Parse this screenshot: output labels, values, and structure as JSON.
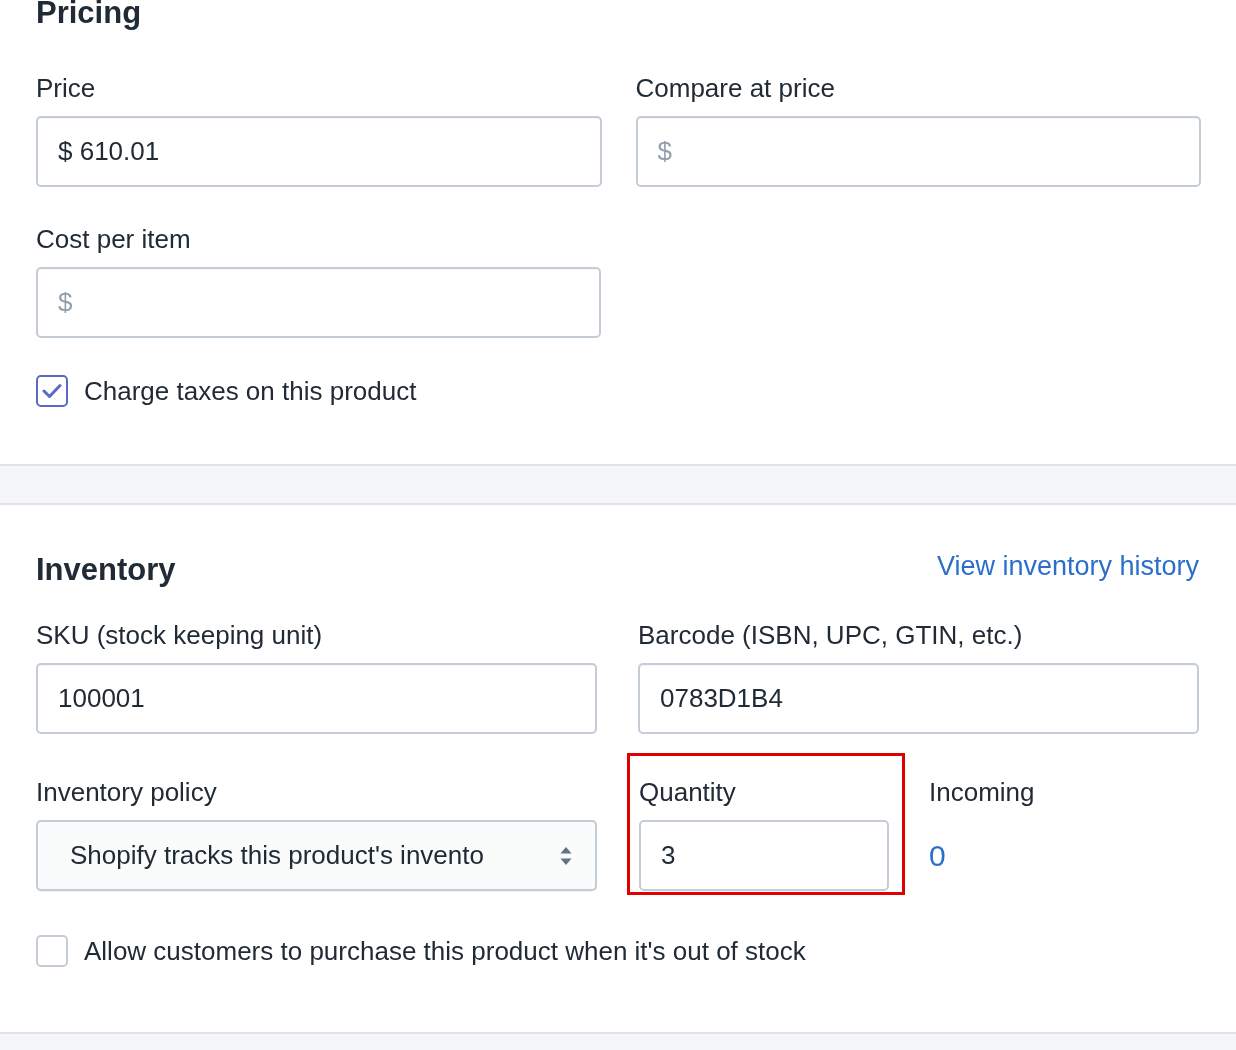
{
  "pricing": {
    "title": "Pricing",
    "fields": [
      {
        "label": "Price",
        "value": "$ 610.01"
      },
      {
        "label": "Compare at price",
        "placeholder": "$"
      },
      {
        "label": "Cost per item",
        "placeholder": "$"
      }
    ],
    "charge_taxes": {
      "label": "Charge taxes on this product",
      "checked": true
    }
  },
  "inventory": {
    "title": "Inventory",
    "history_link": "View inventory history",
    "sku": {
      "label": "SKU (stock keeping unit)",
      "value": "100001"
    },
    "barcode": {
      "label": "Barcode (ISBN, UPC, GTIN, etc.)",
      "value": "0783D1B4"
    },
    "policy": {
      "label": "Inventory policy",
      "value": "Shopify tracks this product's invento"
    },
    "quantity": {
      "label": "Quantity",
      "value": "3",
      "highlighted": true
    },
    "incoming": {
      "label": "Incoming",
      "value": "0"
    },
    "allow_oversell": {
      "label": "Allow customers to purchase this product when it's out of stock",
      "checked": false
    }
  }
}
